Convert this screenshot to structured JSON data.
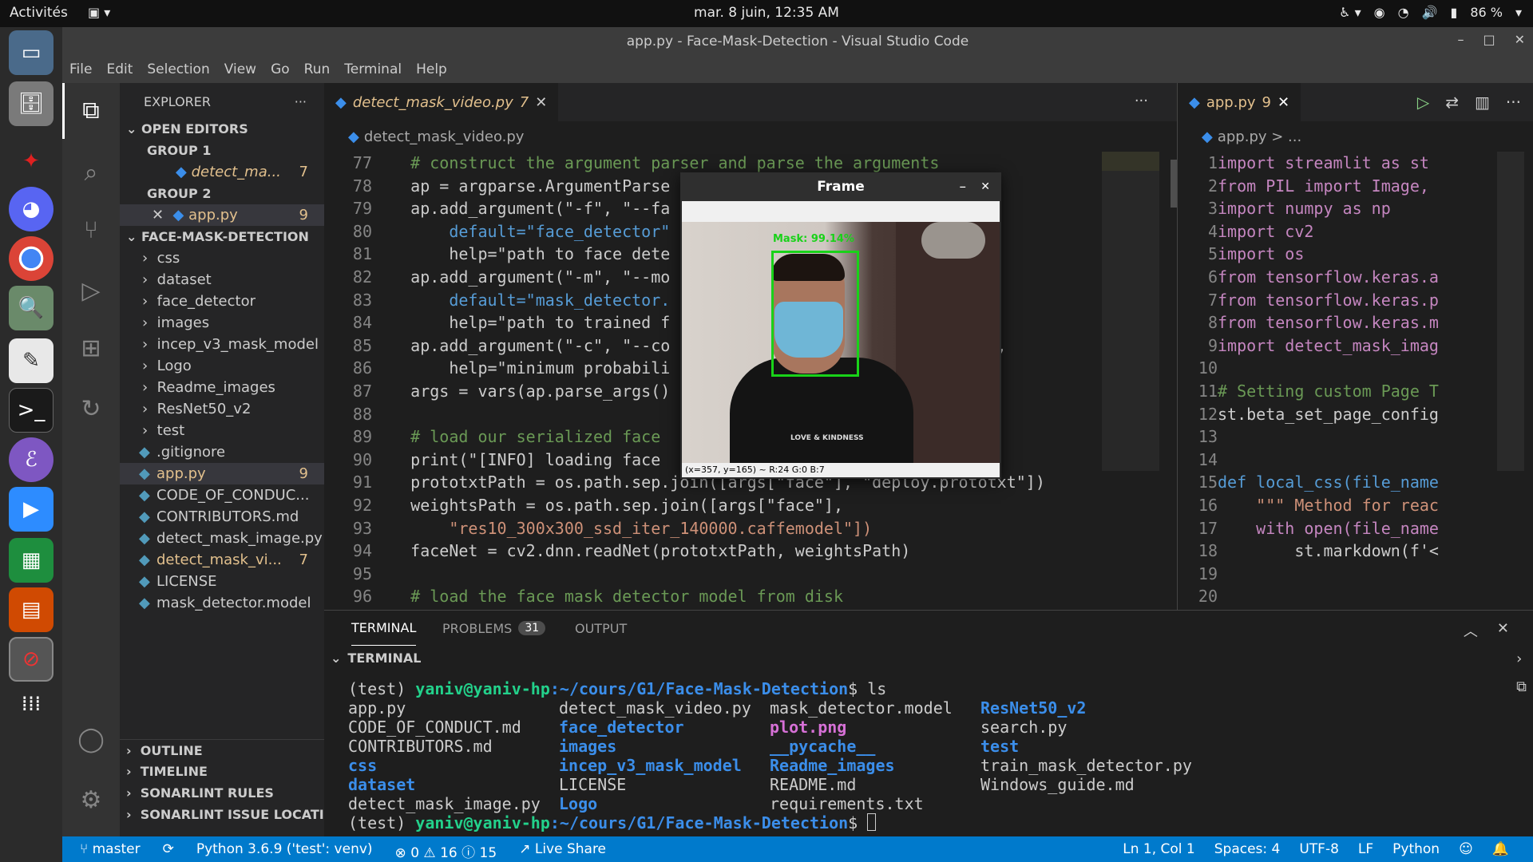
{
  "topbar": {
    "activities": "Activités",
    "clock": "mar. 8 juin, 12:35 AM",
    "battery": "86 %"
  },
  "window": {
    "title": "app.py - Face-Mask-Detection - Visual Studio Code"
  },
  "menu": [
    "File",
    "Edit",
    "Selection",
    "View",
    "Go",
    "Run",
    "Terminal",
    "Help"
  ],
  "explorer": {
    "title": "EXPLORER",
    "open_editors": "OPEN EDITORS",
    "group1": "GROUP 1",
    "group1_file": "detect_ma...",
    "group1_badge": "7",
    "group2": "GROUP 2",
    "group2_file": "app.py",
    "group2_badge": "9",
    "project": "FACE-MASK-DETECTION",
    "folders": [
      "css",
      "dataset",
      "face_detector",
      "images",
      "incep_v3_mask_model",
      "Logo",
      "Readme_images",
      "ResNet50_v2",
      "test"
    ],
    "files": [
      {
        "name": ".gitignore",
        "badge": ""
      },
      {
        "name": "app.py",
        "badge": "9"
      },
      {
        "name": "CODE_OF_CONDUC...",
        "badge": ""
      },
      {
        "name": "CONTRIBUTORS.md",
        "badge": ""
      },
      {
        "name": "detect_mask_image.py",
        "badge": ""
      },
      {
        "name": "detect_mask_vi...",
        "badge": "7"
      },
      {
        "name": "LICENSE",
        "badge": ""
      },
      {
        "name": "mask_detector.model",
        "badge": ""
      }
    ],
    "outline": "OUTLINE",
    "timeline": "TIMELINE",
    "sonar_rules": "SONARLINT RULES",
    "sonar_issues": "SONARLINT ISSUE LOCATI..."
  },
  "editor1": {
    "tab": "detect_mask_video.py",
    "tab_badge": "7",
    "breadcrumb": "detect_mask_video.py",
    "lines": [
      {
        "n": "77",
        "text": "    # construct the argument parser and parse the arguments"
      },
      {
        "n": "78",
        "text": "    ap = argparse.ArgumentParse"
      },
      {
        "n": "79",
        "text": "    ap.add_argument(\"-f\", \"--fa"
      },
      {
        "n": "80",
        "text": "        default=\"face_detector\""
      },
      {
        "n": "81",
        "text": "        help=\"path to face dete"
      },
      {
        "n": "82",
        "text": "    ap.add_argument(\"-m\", \"--mo"
      },
      {
        "n": "83",
        "text": "        default=\"mask_detector."
      },
      {
        "n": "84",
        "text": "        help=\"path to trained f"
      },
      {
        "n": "85",
        "text": "    ap.add_argument(\"-c\", \"--co                                .5,"
      },
      {
        "n": "86",
        "text": "        help=\"minimum probabili"
      },
      {
        "n": "87",
        "text": "    args = vars(ap.parse_args()"
      },
      {
        "n": "88",
        "text": ""
      },
      {
        "n": "89",
        "text": "    # load our serialized face"
      },
      {
        "n": "90",
        "text": "    print(\"[INFO] loading face"
      },
      {
        "n": "91",
        "text": "    prototxtPath = os.path.sep.join([args[\"face\"], \"deploy.prototxt\"])"
      },
      {
        "n": "92",
        "text": "    weightsPath = os.path.sep.join([args[\"face\"],"
      },
      {
        "n": "93",
        "text": "        \"res10_300x300_ssd_iter_140000.caffemodel\"])"
      },
      {
        "n": "94",
        "text": "    faceNet = cv2.dnn.readNet(prototxtPath, weightsPath)"
      },
      {
        "n": "95",
        "text": ""
      },
      {
        "n": "96",
        "text": "    # load the face mask detector model from disk"
      }
    ]
  },
  "editor2": {
    "tab": "app.py",
    "tab_badge": "9",
    "breadcrumb": "app.py > ...",
    "lines": [
      {
        "n": "1",
        "text": "import streamlit as st"
      },
      {
        "n": "2",
        "text": "from PIL import Image,"
      },
      {
        "n": "3",
        "text": "import numpy as np"
      },
      {
        "n": "4",
        "text": "import cv2"
      },
      {
        "n": "5",
        "text": "import os"
      },
      {
        "n": "6",
        "text": "from tensorflow.keras.a"
      },
      {
        "n": "7",
        "text": "from tensorflow.keras.p"
      },
      {
        "n": "8",
        "text": "from tensorflow.keras.m"
      },
      {
        "n": "9",
        "text": "import detect_mask_imag"
      },
      {
        "n": "10",
        "text": ""
      },
      {
        "n": "11",
        "text": "# Setting custom Page T"
      },
      {
        "n": "12",
        "text": "st.beta_set_page_config"
      },
      {
        "n": "13",
        "text": ""
      },
      {
        "n": "14",
        "text": ""
      },
      {
        "n": "15",
        "text": "def local_css(file_name"
      },
      {
        "n": "16",
        "text": "    \"\"\" Method for reac"
      },
      {
        "n": "17",
        "text": "    with open(file_name"
      },
      {
        "n": "18",
        "text": "        st.markdown(f'<"
      },
      {
        "n": "19",
        "text": ""
      },
      {
        "n": "20",
        "text": ""
      }
    ]
  },
  "frame_window": {
    "title": "Frame",
    "label": "Mask: 99.14%",
    "shirt_text": "LOVE & KINDNESS",
    "status": "(x=357, y=165) ~ R:24 G:0 B:7"
  },
  "panel": {
    "tabs": [
      "TERMINAL",
      "PROBLEMS",
      "OUTPUT"
    ],
    "problems_count": "31",
    "section": "TERMINAL",
    "prompt_env": "(test) ",
    "prompt_user": "yaniv@yaniv-hp",
    "prompt_path": ":~/cours/G1/Face-Mask-Detection",
    "prompt_cmd": "$ ls",
    "prompt_end": "$ ",
    "ls_rows": [
      [
        {
          "t": "app.py",
          "c": ""
        },
        {
          "t": "detect_mask_video.py",
          "c": ""
        },
        {
          "t": "mask_detector.model",
          "c": ""
        },
        {
          "t": "ResNet50_v2",
          "c": "dir"
        }
      ],
      [
        {
          "t": "CODE_OF_CONDUCT.md",
          "c": ""
        },
        {
          "t": "face_detector",
          "c": "dir"
        },
        {
          "t": "plot.png",
          "c": "mag"
        },
        {
          "t": "search.py",
          "c": ""
        }
      ],
      [
        {
          "t": "CONTRIBUTORS.md",
          "c": ""
        },
        {
          "t": "images",
          "c": "dir"
        },
        {
          "t": "__pycache__",
          "c": "dir"
        },
        {
          "t": "test",
          "c": "dir"
        }
      ],
      [
        {
          "t": "css",
          "c": "dir"
        },
        {
          "t": "incep_v3_mask_model",
          "c": "dir"
        },
        {
          "t": "Readme_images",
          "c": "dir"
        },
        {
          "t": "train_mask_detector.py",
          "c": ""
        }
      ],
      [
        {
          "t": "dataset",
          "c": "dir"
        },
        {
          "t": "LICENSE",
          "c": ""
        },
        {
          "t": "README.md",
          "c": ""
        },
        {
          "t": "Windows_guide.md",
          "c": ""
        }
      ],
      [
        {
          "t": "detect_mask_image.py",
          "c": ""
        },
        {
          "t": "Logo",
          "c": "dir"
        },
        {
          "t": "requirements.txt",
          "c": ""
        },
        {
          "t": "",
          "c": ""
        }
      ]
    ]
  },
  "status": {
    "branch": "master",
    "python": "Python 3.6.9 ('test': venv)",
    "errors": "0",
    "warnings": "16",
    "infos": "15",
    "liveshare": "Live Share",
    "position": "Ln 1, Col 1",
    "spaces": "Spaces: 4",
    "encoding": "UTF-8",
    "eol": "LF",
    "language": "Python"
  },
  "colors": {
    "accent": "#007acc",
    "modified": "#e2c08d",
    "terminal_green": "#23d18b",
    "terminal_blue": "#3b8eea"
  }
}
